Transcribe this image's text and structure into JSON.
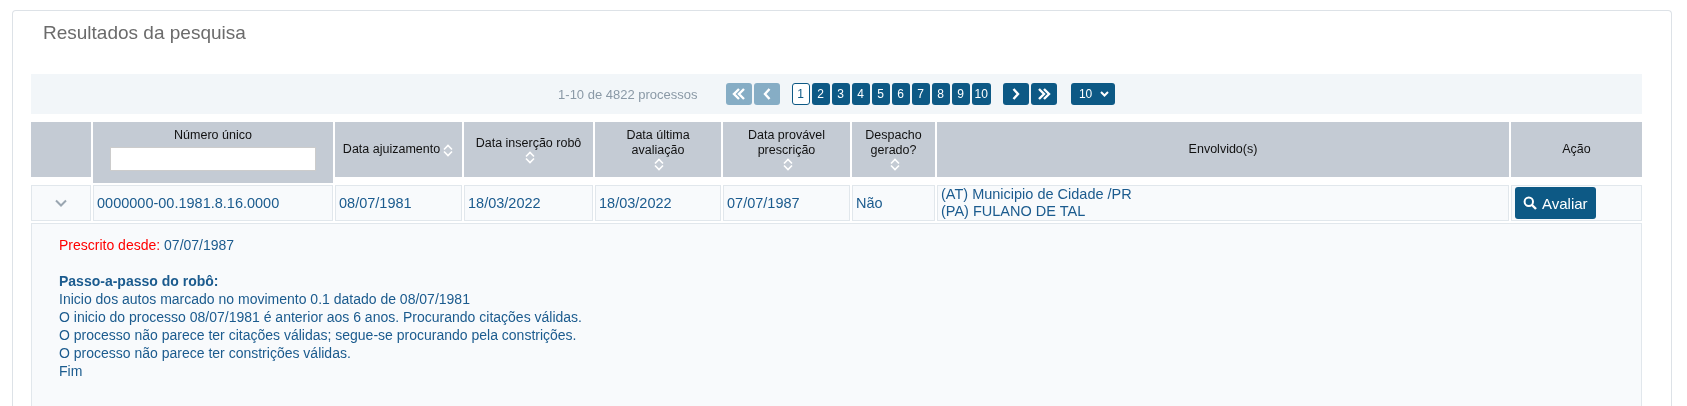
{
  "title": "Resultados da pesquisa",
  "pagination": {
    "summary": "1-10 de 4822 processos",
    "nav": [
      {
        "kind": "first",
        "disabled": true
      },
      {
        "kind": "prev",
        "disabled": true
      }
    ],
    "pages": [
      {
        "label": "1",
        "selected": true
      },
      {
        "label": "2",
        "selected": false
      },
      {
        "label": "3",
        "selected": false
      },
      {
        "label": "4",
        "selected": false
      },
      {
        "label": "5",
        "selected": false
      },
      {
        "label": "6",
        "selected": false
      },
      {
        "label": "7",
        "selected": false
      },
      {
        "label": "8",
        "selected": false
      },
      {
        "label": "9",
        "selected": false
      },
      {
        "label": "10",
        "selected": false
      }
    ],
    "nav_after": [
      {
        "kind": "next",
        "disabled": false
      },
      {
        "kind": "last",
        "disabled": false
      }
    ],
    "page_size": "10"
  },
  "table": {
    "columns": [
      {
        "kind": "toggle"
      },
      {
        "kind": "filter",
        "label": "Número único"
      },
      {
        "kind": "sortable",
        "label": "Data ajuizamento"
      },
      {
        "kind": "sortable",
        "label": "Data inserção robô"
      },
      {
        "kind": "sortable",
        "label": "Data última avaliação"
      },
      {
        "kind": "sortable",
        "label": "Data provável prescrição"
      },
      {
        "kind": "sortable",
        "label": "Despacho gerado?"
      },
      {
        "kind": "plain",
        "label": "Envolvido(s)"
      },
      {
        "kind": "plain",
        "label": "Ação"
      }
    ],
    "rows": [
      {
        "expanded": true,
        "cells": [
          "",
          "0000000-00.1981.8.16.0000",
          "08/07/1981",
          "18/03/2022",
          "18/03/2022",
          "07/07/1987",
          "Não"
        ],
        "parties": [
          "(AT) Municipio de Cidade /PR",
          "(PA) FULANO DE TAL"
        ],
        "action": "Avaliar",
        "detail": {
          "prescribed_label": "Prescrito desde:",
          "prescribed_date": "07/07/1987",
          "steps_title": "Passo-a-passo do robô:",
          "steps": [
            "Inicio dos autos marcado no movimento 0.1 datado de 08/07/1981",
            "O inicio do processo 08/07/1981 é anterior aos 6 anos. Procurando citações válidas.",
            "O processo não parece ter citações válidas; segue-se procurando pela constrições.",
            "O processo não parece ter constrições válidas.",
            "Fim"
          ]
        }
      }
    ]
  }
}
